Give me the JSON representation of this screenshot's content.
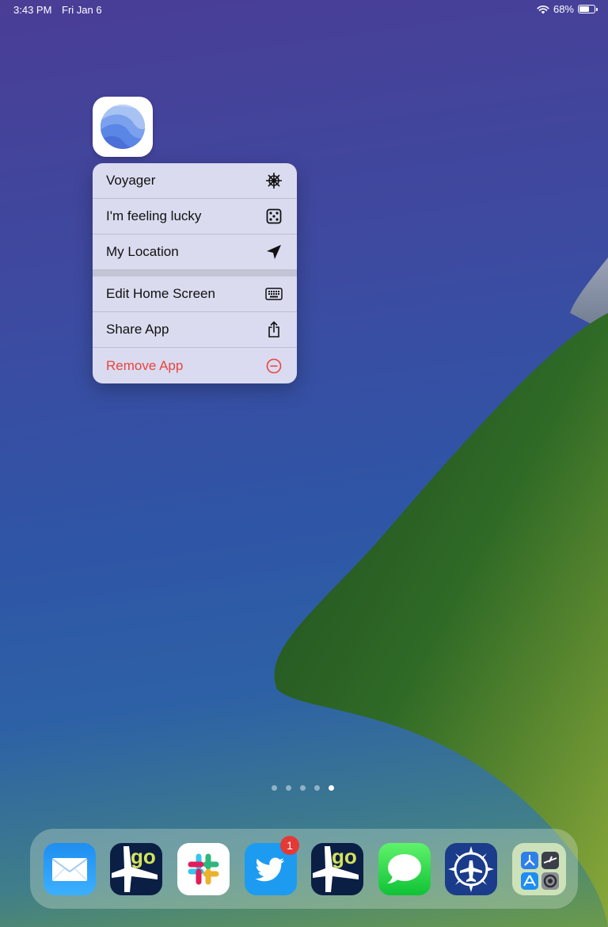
{
  "status_bar": {
    "time": "3:43 PM",
    "date": "Fri Jan 6",
    "battery": "68%",
    "battery_level": 0.68
  },
  "app": {
    "icon": "google-earth-icon"
  },
  "context_menu": {
    "items": [
      {
        "label": "Voyager",
        "icon": "ship-wheel-icon"
      },
      {
        "label": "I'm feeling lucky",
        "icon": "dice-icon"
      },
      {
        "label": "My Location",
        "icon": "location-arrow-icon"
      }
    ],
    "items2": [
      {
        "label": "Edit Home Screen",
        "icon": "keyboard-icon"
      },
      {
        "label": "Share App",
        "icon": "share-icon"
      },
      {
        "label": "Remove App",
        "icon": "minus-circle-icon",
        "color": "#e8453c"
      }
    ]
  },
  "page_indicator": {
    "count": 5,
    "active": 5
  },
  "dock": {
    "apps": [
      {
        "name": "mail-app",
        "icon": "envelope-icon"
      },
      {
        "name": "flightaware-go-app",
        "icon": "plane-go-icon"
      },
      {
        "name": "slack-app",
        "icon": "slack-icon"
      },
      {
        "name": "twitter-app",
        "icon": "bird-icon",
        "badge": "1"
      },
      {
        "name": "flightaware-go-app-2",
        "icon": "plane-go-icon"
      },
      {
        "name": "messages-app",
        "icon": "speech-bubble-icon"
      },
      {
        "name": "flight-app",
        "icon": "compass-plane-icon"
      },
      {
        "name": "app-library-folder",
        "icon": "folder-icon"
      }
    ]
  }
}
